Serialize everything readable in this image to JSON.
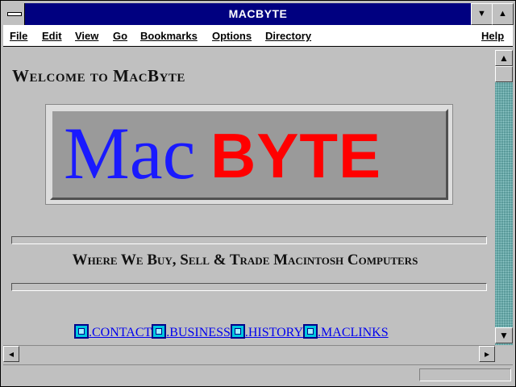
{
  "window": {
    "title": "MACBYTE"
  },
  "menu": {
    "items": [
      "File",
      "Edit",
      "View",
      "Go",
      "Bookmarks",
      "Options",
      "Directory"
    ],
    "help": "Help"
  },
  "page": {
    "heading": "Welcome to MacByte",
    "logo": {
      "mac": "Mac",
      "byte": "BYTE"
    },
    "tagline": "Where We Buy, Sell & Trade Macintosh Computers",
    "links": [
      ".CONTACT",
      ".BUSINESS",
      ".HISTORY",
      ".MACLINKS"
    ]
  },
  "colors": {
    "title_bar": "#000080",
    "link": "#0000ee",
    "logo_blue": "#1a1aff",
    "logo_red": "#ff0000"
  }
}
